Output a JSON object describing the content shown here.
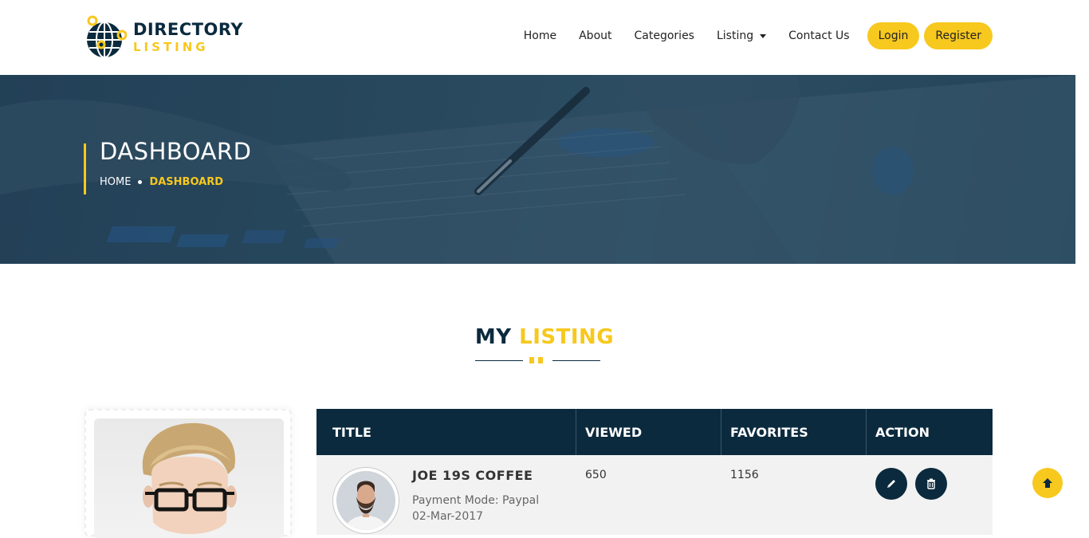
{
  "brand": {
    "name_top": "DIRECTORY",
    "name_bottom": "LISTING"
  },
  "nav": {
    "items": [
      "Home",
      "About",
      "Categories",
      "Listing",
      "Contact Us"
    ],
    "login": "Login",
    "register": "Register"
  },
  "banner": {
    "title": "DASHBOARD",
    "breadcrumb_home": "HOME",
    "breadcrumb_current": "DASHBOARD"
  },
  "section": {
    "title_dark": "MY",
    "title_yellow": "LISTING"
  },
  "table": {
    "headers": [
      "TITLE",
      "VIEWED",
      "FAVORITES",
      "ACTION"
    ],
    "rows": [
      {
        "name": "JOE 19S COFFEE",
        "payment": "Payment Mode: Paypal",
        "date": "02-Mar-2017",
        "viewed": "650",
        "favorites": "1156"
      }
    ]
  },
  "colors": {
    "accent": "#f7c81e",
    "navy": "#0b2a3e"
  },
  "icons": [
    "globe-icon",
    "caret-down-icon",
    "pencil-icon",
    "trash-icon",
    "arrow-up-icon"
  ]
}
